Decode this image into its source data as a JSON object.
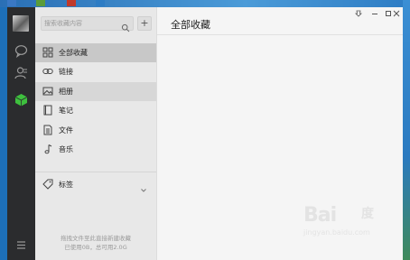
{
  "search": {
    "placeholder": "搜索收藏内容"
  },
  "add_button": {
    "label": "+"
  },
  "menu": [
    {
      "label": "全部收藏",
      "icon": "grid-icon"
    },
    {
      "label": "链接",
      "icon": "link-icon"
    },
    {
      "label": "相册",
      "icon": "image-icon"
    },
    {
      "label": "笔记",
      "icon": "note-icon"
    },
    {
      "label": "文件",
      "icon": "file-icon"
    },
    {
      "label": "音乐",
      "icon": "music-icon"
    }
  ],
  "tags": {
    "label": "标签",
    "icon": "tag-icon"
  },
  "footer": {
    "line1": "拖拽文件至此直接新建收藏",
    "line2": "已使用0B，总可用2.0G"
  },
  "main": {
    "title": "全部收藏"
  },
  "watermark": {
    "brand": "Bai",
    "paw": "度",
    "sub": "jingyan.baidu.com"
  },
  "colors": {
    "sidebar": "#2b2c2e",
    "list_bg": "#e8e8e8",
    "active_item": "#c8c8c8",
    "favorites_icon": "#3ec03e"
  }
}
